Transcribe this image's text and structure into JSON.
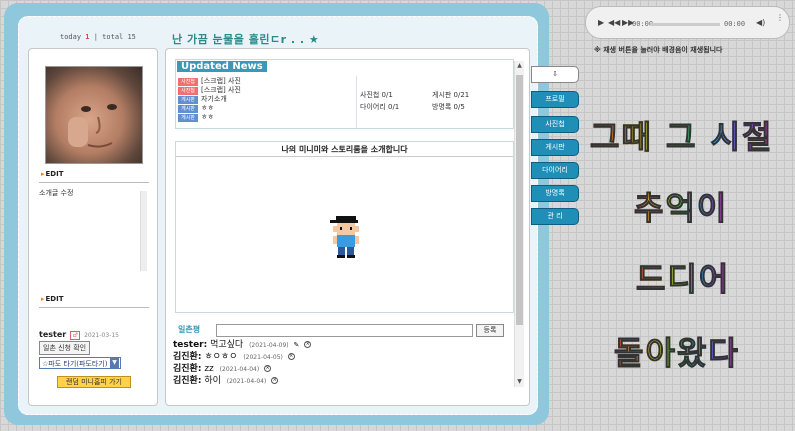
{
  "header": {
    "today_label": "today",
    "today_count": "1",
    "total_label": "total",
    "total_count": "15",
    "title": "난 가끔 눈물을 흘린ㄷr . . ★"
  },
  "profile": {
    "edit_label": "EDIT",
    "bio": "소개글 수정",
    "edit_label_2": "EDIT",
    "owner_name": "tester",
    "owner_gender": "♂",
    "owner_date": "2021-03-15",
    "ilchon_button": "일촌 신청 확인",
    "wave_select": "☆파도 타기(파도타기)",
    "random_button": "랜덤 미니홈피 가기"
  },
  "news": {
    "title": "Updated News",
    "items": [
      {
        "tag": "사진첩",
        "tag_color": "#f07070",
        "text": "[스크랩] 사진"
      },
      {
        "tag": "사진첩",
        "tag_color": "#f07070",
        "text": "[스크랩] 사진"
      },
      {
        "tag": "게시판",
        "tag_color": "#6090d0",
        "text": "자기소개"
      },
      {
        "tag": "게시판",
        "tag_color": "#6090d0",
        "text": "ㅎㅎ"
      },
      {
        "tag": "게시판",
        "tag_color": "#6090d0",
        "text": "ㅎㅎ"
      }
    ],
    "stats": {
      "photo": "사진첩 0/1",
      "board": "게시판 0/21",
      "diary": "다이어리 0/1",
      "guestbook": "방명록 0/5"
    }
  },
  "miniroom": {
    "title": "나의 미니미와 스토리룸을 소개합니다"
  },
  "comments": {
    "label": "일촌평",
    "submit_label": "등록",
    "input_value": "",
    "items": [
      {
        "author": "tester:",
        "text": "먹고싶다",
        "date": "(2021-04-09)"
      },
      {
        "author": "김진환:",
        "text": "ㅎㅇㅎㅇ",
        "date": "(2021-04-05)"
      },
      {
        "author": "김진환:",
        "text": "zz",
        "date": "(2021-04-04)"
      },
      {
        "author": "김진환:",
        "text": "하이",
        "date": "(2021-04-04)"
      }
    ]
  },
  "tabs": [
    {
      "label": "⇩",
      "icon": "home-icon"
    },
    {
      "label": "프로필"
    },
    {
      "label": "사진첩"
    },
    {
      "label": "게시판"
    },
    {
      "label": "다이어리"
    },
    {
      "label": "방명록"
    },
    {
      "label": "관 리"
    }
  ],
  "player": {
    "current_time": "00:00",
    "total_time": "00:00",
    "note": "※ 재생 버튼을 눌러야 배경음이 재생됩니다"
  },
  "banner": {
    "line1": "그때 그 시절",
    "line2": "추억이",
    "line3": "드디어",
    "line4": "돌아왔다"
  },
  "colors": {
    "frame": "#8fc7dc",
    "accent": "#1f8fb8",
    "news_title_bg": "#3a98b8"
  }
}
